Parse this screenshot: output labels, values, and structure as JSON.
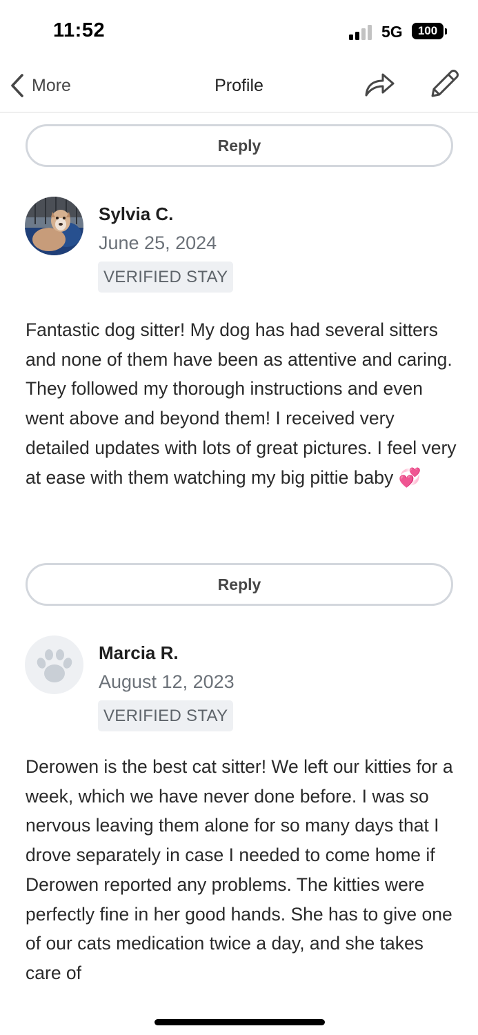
{
  "status_bar": {
    "time": "11:52",
    "network": "5G",
    "battery": "100"
  },
  "nav": {
    "back_label": "More",
    "title": "Profile",
    "icons": [
      "chevron-left-icon",
      "share-icon",
      "edit-pencil-icon"
    ]
  },
  "reply_label": "Reply",
  "reviews": [
    {
      "name": "Sylvia C.",
      "date": "June 25, 2024",
      "badge": "VERIFIED STAY",
      "avatar": "dog-photo",
      "text": "Fantastic dog sitter! My dog has had several sitters and none of them have been as attentive and caring. They followed my thorough instructions and even went above and beyond them! I received very detailed updates with lots of great pictures. I feel very at ease with them watching my big pittie baby 💞"
    },
    {
      "name": "Marcia R.",
      "date": "August 12, 2023",
      "badge": "VERIFIED STAY",
      "avatar": "paw-icon",
      "text": "Derowen is the best cat sitter! We left our kitties for a week, which we have never done before. I was so nervous leaving them alone for so many days that I drove separately in case I needed to come home if Derowen reported any problems. The kitties were perfectly fine in her good hands. She has to give one of our cats medication twice a day, and she takes care of"
    }
  ],
  "colors": {
    "text": "#1f1f1f",
    "muted": "#6b7178",
    "badge_bg": "#eef0f3",
    "border": "#d3d7dd"
  }
}
